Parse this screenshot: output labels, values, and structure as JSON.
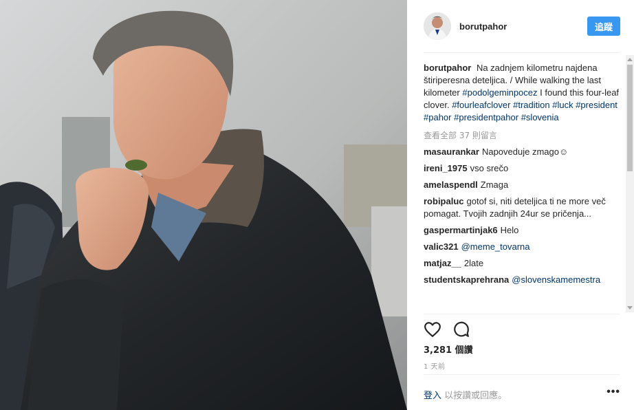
{
  "post": {
    "username": "borutpahor",
    "follow_label": "追蹤",
    "caption": {
      "username": "borutpahor",
      "text": "Na zadnjem kilometru najdena štiriperesna deteljica. / While walking the last kilometer",
      "tag1": "#podolgeminpocez",
      "text2": "I found this four-leaf clover.",
      "tags": [
        "#fourleafclover",
        "#tradition",
        "#luck",
        "#president",
        "#pahor",
        "#presidentpahor",
        "#slovenia"
      ]
    },
    "view_all_comments": "查看全部 37 則留言",
    "comments": [
      {
        "user": "masaurankar",
        "text": "Napoveduje zmago☺"
      },
      {
        "user": "ireni_1975",
        "text": "vso srečo"
      },
      {
        "user": "amelaspendl",
        "text": "Zmaga"
      },
      {
        "user": "robipaluc",
        "text": "gotof si, niti deteljica ti ne more več pomagat. Tvojih zadnjih 24ur se pričenja..."
      },
      {
        "user": "gaspermartinjak6",
        "text": "Helo"
      },
      {
        "user": "valic321",
        "text": "@meme_tovarna",
        "is_mention": true
      },
      {
        "user": "matjaz__",
        "text": "2late"
      },
      {
        "user": "studentskaprehrana",
        "text": "@slovenskamemestra",
        "is_mention": true
      }
    ],
    "likes": "3,281 個讚",
    "time": "1 天前",
    "login_link": "登入",
    "login_text": "以按讚或回應。",
    "more": "•••"
  },
  "icons": {
    "like": "heart-icon",
    "comment": "comment-icon",
    "more": "more-options-icon"
  },
  "colors": {
    "follow_button": "#3897f0",
    "link": "#003569",
    "muted": "#999999"
  }
}
